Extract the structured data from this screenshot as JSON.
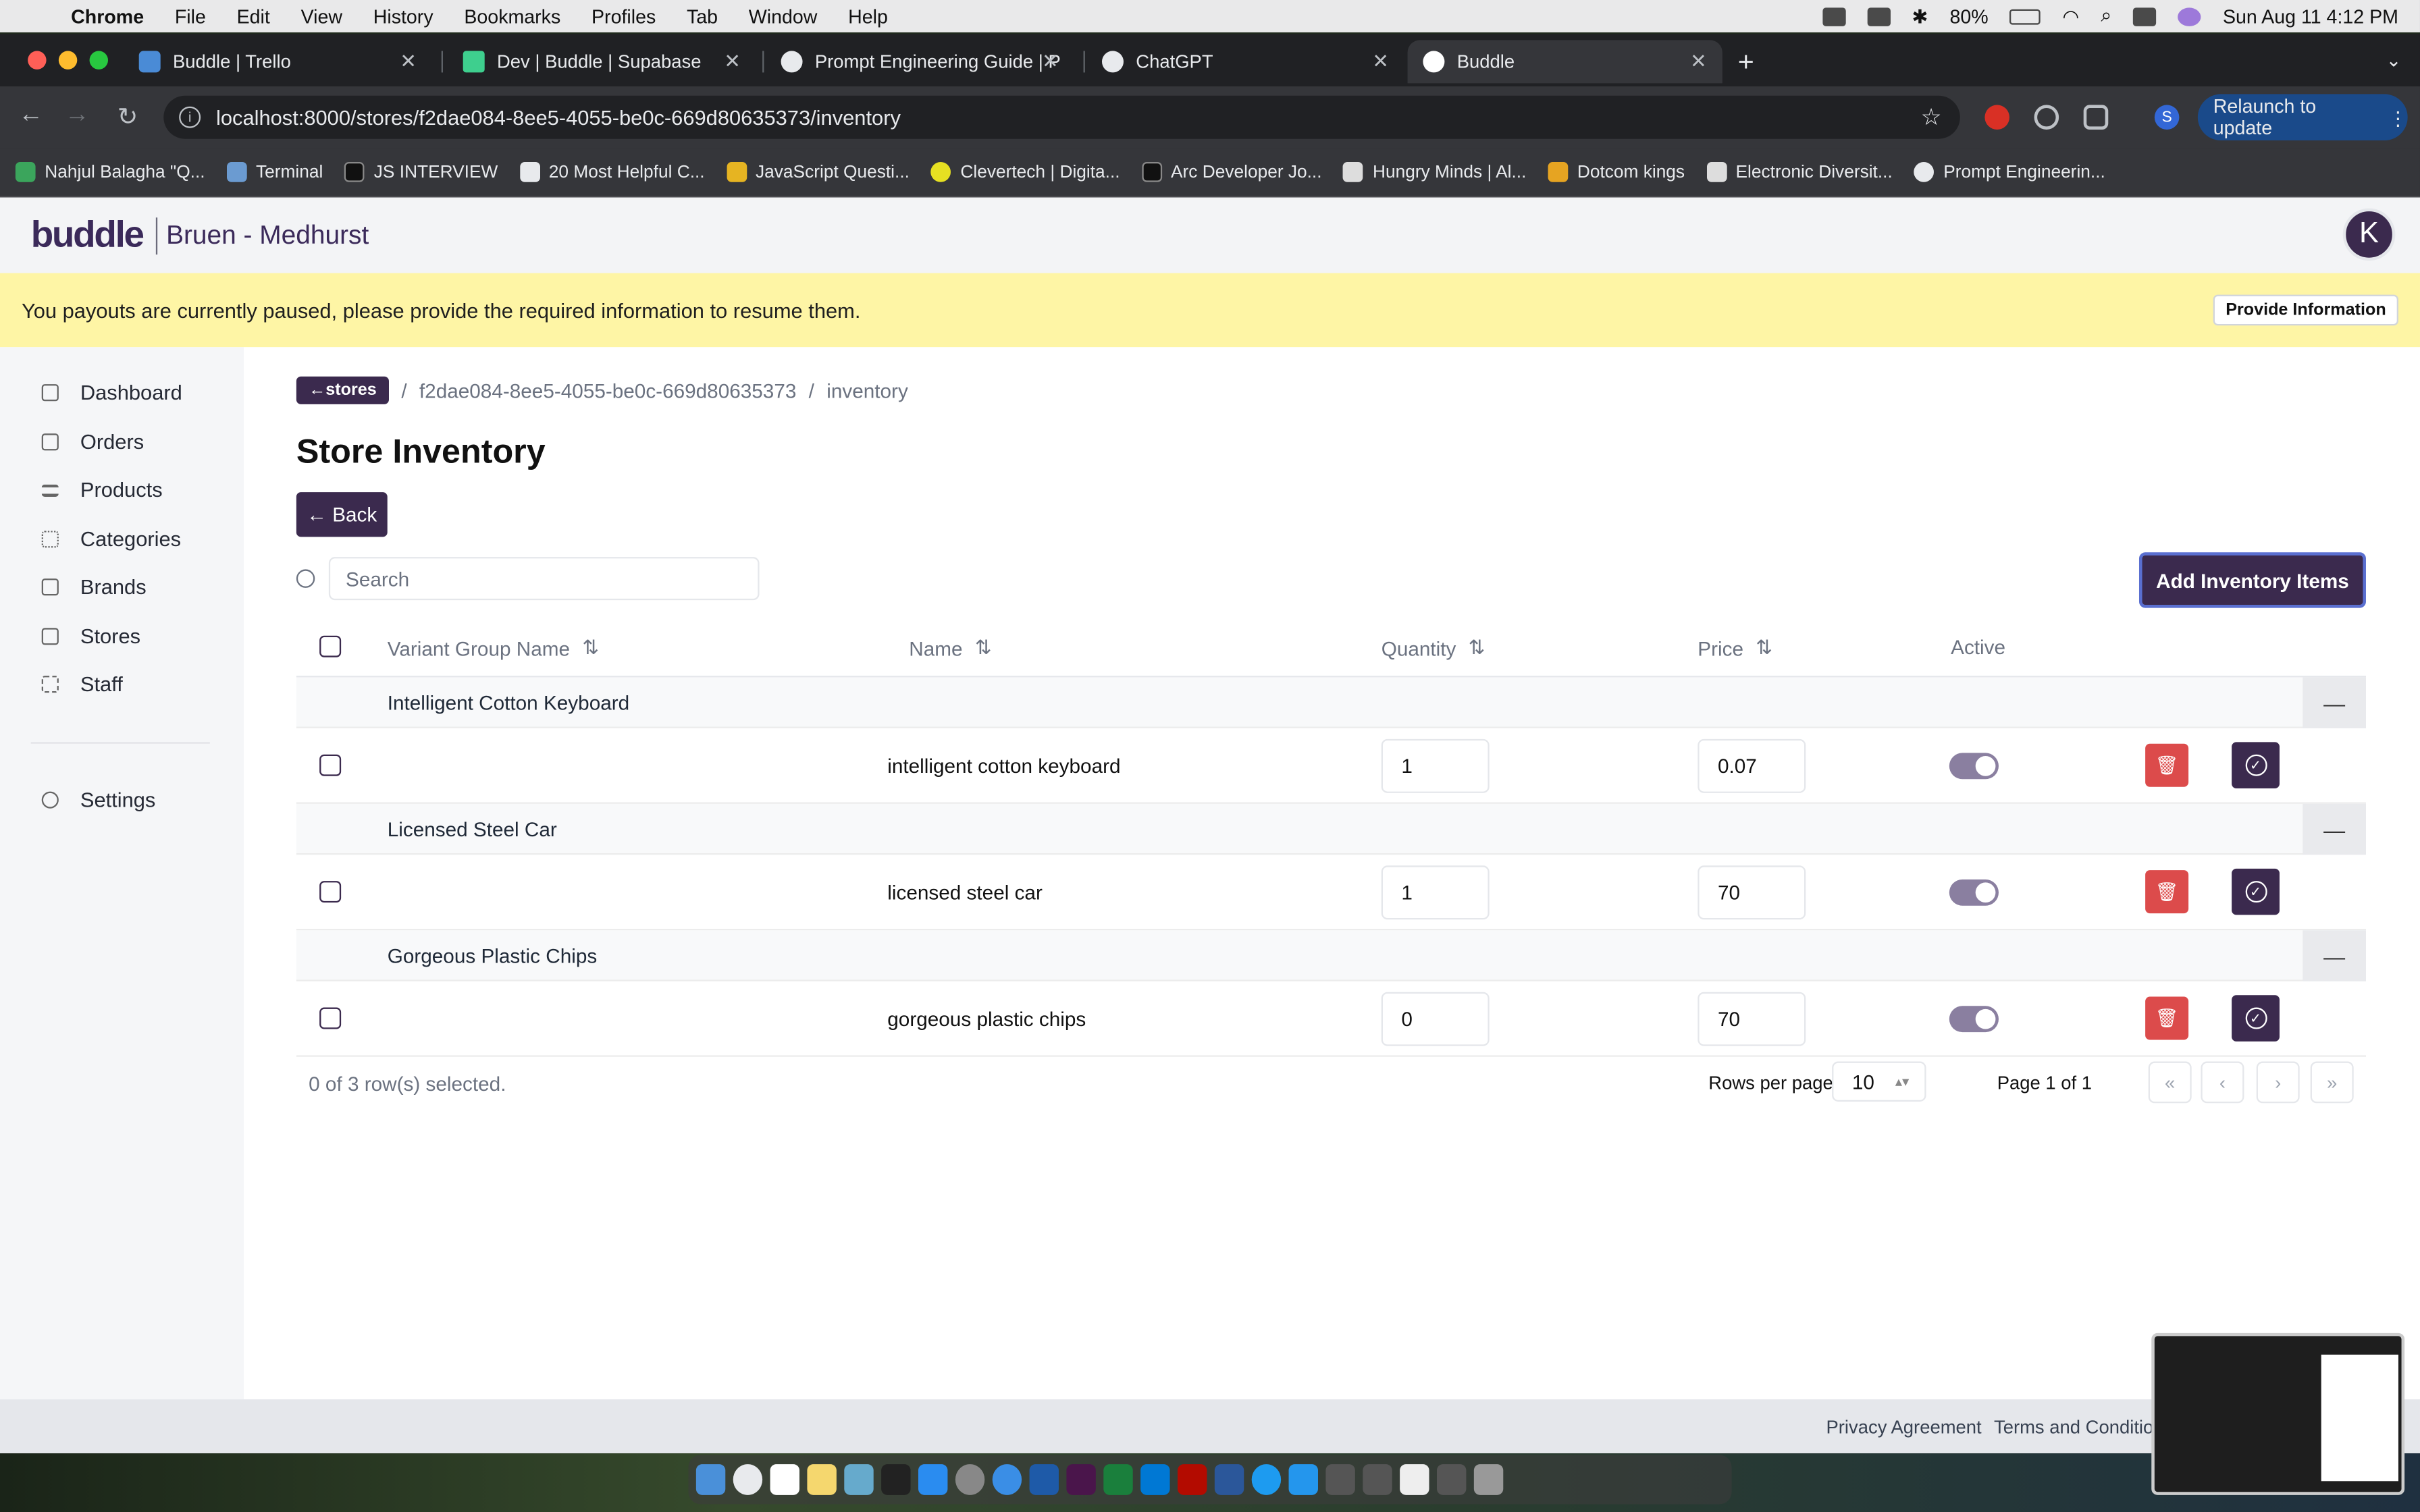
{
  "menubar": {
    "app": "Chrome",
    "menus": [
      "File",
      "Edit",
      "View",
      "History",
      "Bookmarks",
      "Profiles",
      "Tab",
      "Window",
      "Help"
    ],
    "battery": "80%",
    "datetime": "Sun Aug 11  4:12 PM"
  },
  "browser": {
    "tabs": [
      {
        "title": "Buddle | Trello",
        "color": "#4a8bd6"
      },
      {
        "title": "Dev | Buddle | Supabase",
        "color": "#3ecf8e"
      },
      {
        "title": "Prompt Engineering Guide | P",
        "color": "#e8eaed"
      },
      {
        "title": "ChatGPT",
        "color": "#e8eaed"
      },
      {
        "title": "Buddle",
        "color": "#ffffff"
      }
    ],
    "url": "localhost:8000/stores/f2dae084-8ee5-4055-be0c-669d80635373/inventory",
    "profile_initial": "S",
    "relaunch_label": "Relaunch to update",
    "bookmarks": [
      {
        "label": "Nahjul Balagha \"Q...",
        "color": "#3ba55c"
      },
      {
        "label": "Terminal",
        "color": "#6b9bd1"
      },
      {
        "label": "JS INTERVIEW",
        "color": "#111111"
      },
      {
        "label": "20 Most Helpful C...",
        "color": "#e8eaed"
      },
      {
        "label": "JavaScript Questi...",
        "color": "#e6b422"
      },
      {
        "label": "Clevertech | Digita...",
        "color": "#e6e022"
      },
      {
        "label": "Arc Developer Jo...",
        "color": "#111111"
      },
      {
        "label": "Hungry Minds | Al...",
        "color": "#dddddd"
      },
      {
        "label": "Dotcom kings",
        "color": "#e6a422"
      },
      {
        "label": "Electronic Diversit...",
        "color": "#dddddd"
      },
      {
        "label": "Prompt Engineerin...",
        "color": "#e8eaed"
      }
    ]
  },
  "app": {
    "logo": "buddle",
    "store_name": "Bruen - Medhurst",
    "avatar_initial": "K",
    "banner": {
      "text": "You payouts are currently paused, please provide the required information to resume them.",
      "button": "Provide Information"
    },
    "sidebar": {
      "items": [
        {
          "label": "Dashboard",
          "icon": "monitor-icon"
        },
        {
          "label": "Orders",
          "icon": "receipt-icon"
        },
        {
          "label": "Products",
          "icon": "list-icon"
        },
        {
          "label": "Categories",
          "icon": "grid-icon"
        },
        {
          "label": "Brands",
          "icon": "copy-icon"
        },
        {
          "label": "Stores",
          "icon": "store-icon"
        },
        {
          "label": "Staff",
          "icon": "users-icon"
        }
      ],
      "settings": "Settings"
    },
    "breadcrumb": {
      "back_label": "←stores",
      "sep": "/",
      "store_id": "f2dae084-8ee5-4055-be0c-669d80635373",
      "current": "inventory"
    },
    "title": "Store Inventory",
    "back_button": "← Back",
    "search_placeholder": "Search",
    "add_button": "Add Inventory Items",
    "columns": {
      "group": "Variant Group Name",
      "name": "Name",
      "quantity": "Quantity",
      "price": "Price",
      "active": "Active",
      "sort_icon": "⇅"
    },
    "groups": [
      {
        "group": "Intelligent Cotton Keyboard",
        "name": "intelligent cotton keyboard",
        "quantity": "1",
        "price": "0.07",
        "active": true
      },
      {
        "group": "Licensed Steel Car",
        "name": "licensed steel car",
        "quantity": "1",
        "price": "70",
        "active": true
      },
      {
        "group": "Gorgeous Plastic Chips",
        "name": "gorgeous plastic chips",
        "quantity": "0",
        "price": "70",
        "active": true
      }
    ],
    "selection_info": "0 of 3 row(s) selected.",
    "rows_per_page_label": "Rows per page",
    "rows_per_page": "10",
    "page_info": "Page 1 of 1",
    "footer": {
      "privacy": "Privacy Agreement",
      "terms": "Terms and Conditions"
    }
  },
  "colors": {
    "brand": "#3b2a4e",
    "banner": "#fef5a5",
    "danger": "#dc4b4b"
  }
}
